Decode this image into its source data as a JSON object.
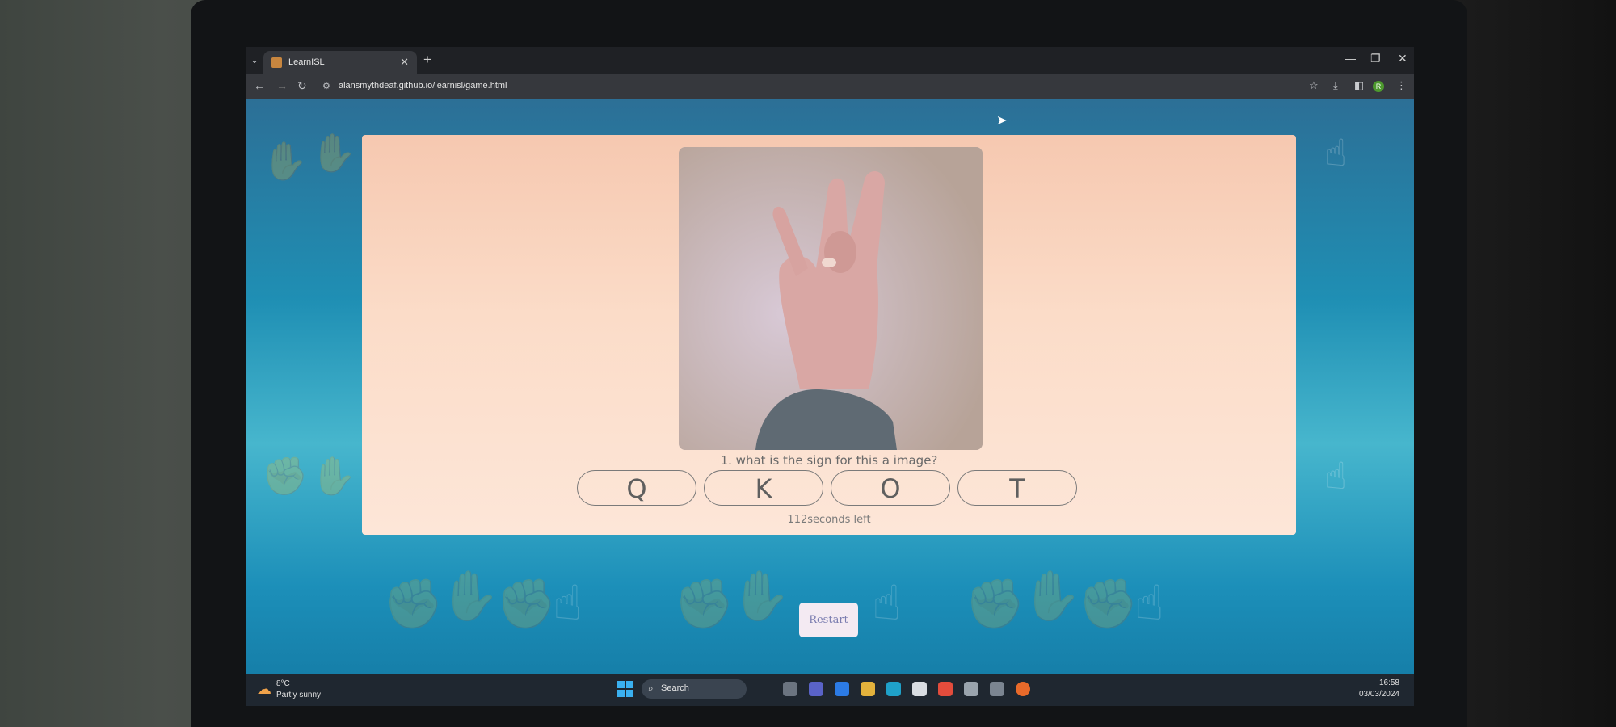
{
  "browser": {
    "tab_title": "LearnISL",
    "url": "alansmythdeaf.github.io/learnisl/game.html",
    "profile_initial": "R"
  },
  "game": {
    "question": "1. what is the sign for this a image?",
    "answers": [
      "Q",
      "K",
      "O",
      "T"
    ],
    "timer": "112seconds left",
    "restart_label": "Restart"
  },
  "taskbar": {
    "weather_temp": "8°C",
    "weather_desc": "Partly sunny",
    "search_label": "Search",
    "time": "16:58",
    "date": "03/03/2024"
  },
  "colors": {
    "page_gradient_top": "#2c6f96",
    "page_gradient_mid": "#47b6cd",
    "card": "#fbdcc8",
    "restart_bg": "#f4eaf2"
  },
  "icons": [
    "tab-list-icon",
    "favicon-icon",
    "close-icon",
    "new-tab-icon",
    "minimize-icon",
    "restore-icon",
    "back-icon",
    "forward-icon",
    "reload-icon",
    "site-info-icon",
    "star-icon",
    "download-icon",
    "sidebar-icon",
    "more-icon",
    "hand-sign-image",
    "windows-start-icon",
    "search-icon",
    "weather-icon"
  ]
}
